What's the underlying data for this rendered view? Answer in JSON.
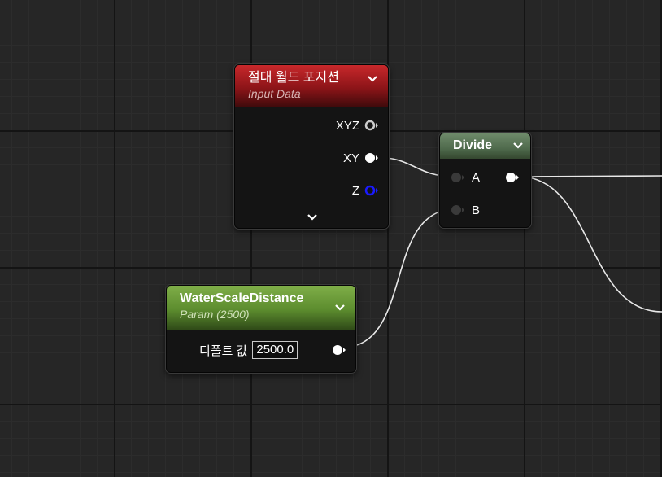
{
  "nodes": {
    "absolute_world_position": {
      "title": "절대 월드 포지션",
      "subtitle": "Input Data",
      "outputs": [
        {
          "label": "XYZ",
          "connected": false
        },
        {
          "label": "XY",
          "connected": true
        },
        {
          "label": "Z",
          "connected": false
        }
      ],
      "header_color": "#b0201f"
    },
    "divide": {
      "title": "Divide",
      "inputs": [
        {
          "label": "A",
          "connected": true
        },
        {
          "label": "B",
          "connected": true
        }
      ],
      "output_connected": true,
      "header_color": "#5a7556"
    },
    "water_scale_distance": {
      "title": "WaterScaleDistance",
      "subtitle": "Param (2500)",
      "default_label": "디폴트 값",
      "default_value": "2500.0",
      "header_color": "#6d9b3b"
    }
  },
  "colors": {
    "wire": "#e8e8e8",
    "pin_float": "#ffffff",
    "pin_vec3": "#cccccc",
    "pin_z": "#1a1aff",
    "pin_disconnected": "#3a3a3a",
    "background": "#262626"
  },
  "icons": {
    "collapse": "chevron-down-icon",
    "expand": "chevron-down-icon"
  }
}
